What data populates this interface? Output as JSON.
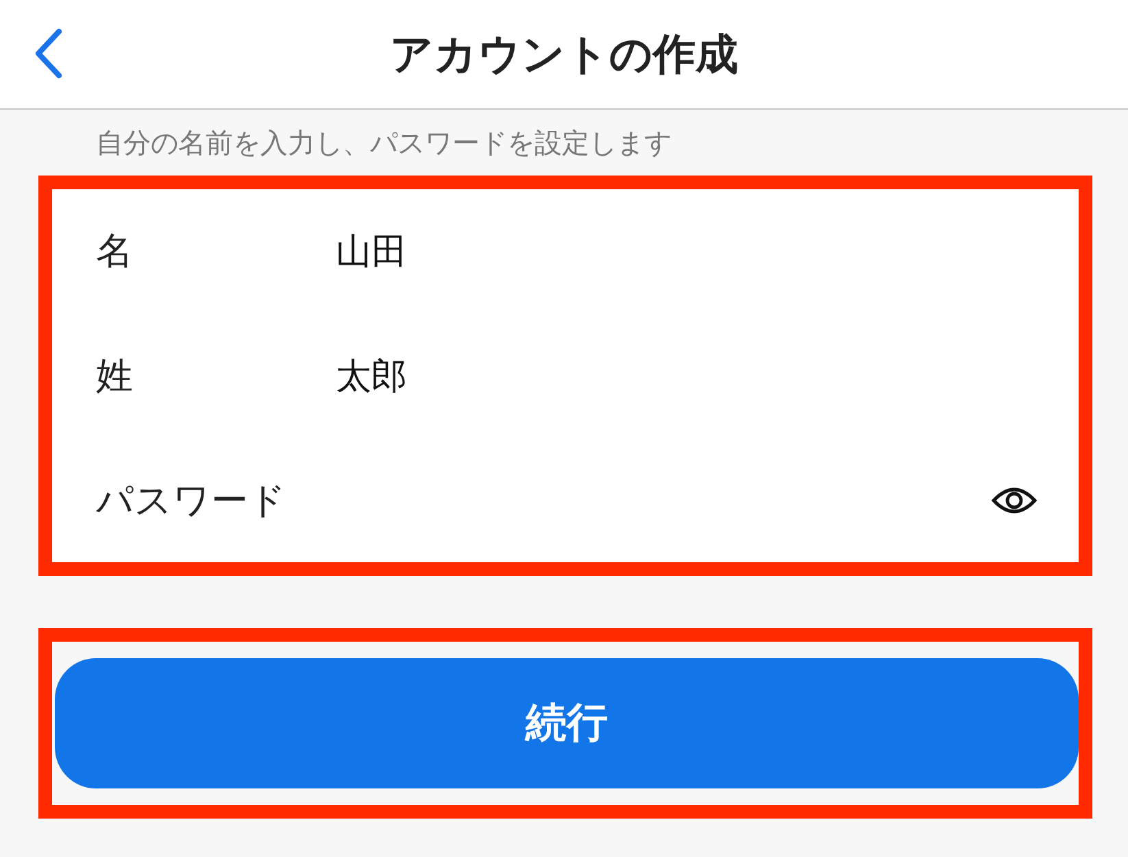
{
  "header": {
    "title": "アカウントの作成"
  },
  "subtitle": "自分の名前を入力し、パスワードを設定します",
  "form": {
    "highlighted": true,
    "fields": [
      {
        "kind": "text",
        "label": "名",
        "value": "山田"
      },
      {
        "kind": "text",
        "label": "姓",
        "value": "太郎"
      },
      {
        "kind": "password",
        "label": "パスワード"
      }
    ]
  },
  "continue_button": {
    "label": "続行",
    "highlighted": true
  }
}
